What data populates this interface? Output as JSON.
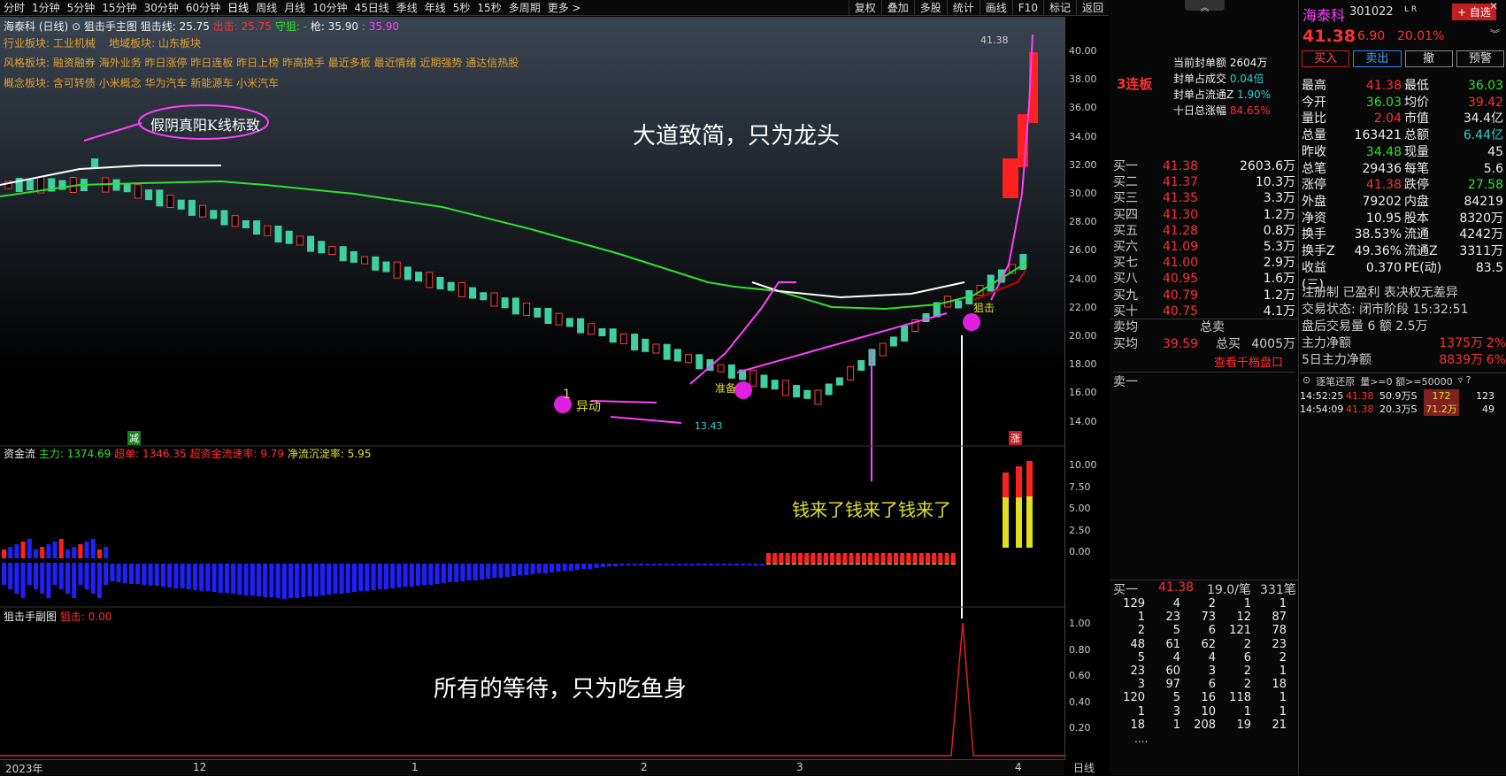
{
  "topbar": {
    "items": [
      "分时",
      "1分钟",
      "5分钟",
      "15分钟",
      "30分钟",
      "60分钟",
      "日线",
      "周线",
      "月线",
      "10分钟",
      "45日线",
      "季线",
      "年线",
      "5秒",
      "15秒",
      "多周期",
      "更多 >"
    ],
    "right": [
      "复权",
      "叠加",
      "多股",
      "统计",
      "画线",
      "F10",
      "标记",
      "返回"
    ]
  },
  "main": {
    "stock_title": "海泰科 (日线)",
    "indicator": "狙击手主图",
    "line1": "狙击线: 25.75",
    "line2": "出击: 25.75",
    "line3": "守狙: -",
    "line4": "枪: 35.90",
    "line5": ": 35.90",
    "sector1": "行业板块: 工业机械",
    "sector2": "地域板块: 山东板块",
    "style_label": "风格板块:",
    "style": "融资融券 海外业务 昨日涨停 昨日连板 昨日上榜 昨高换手 最近多板 最近情绪 近期强势 通达信热股",
    "concept_label": "概念板块:",
    "concept": "含可转债 小米概念 华为汽车 新能源车 小米汽车",
    "ann_kline": "假阴真阳K线标致",
    "ann_main": "大道致简，只为龙头",
    "ann_money": "钱来了钱来了钱来了",
    "ann_wait": "所有的等待，只为吃鱼身",
    "ann_move": "异动",
    "ann_ready": "准备",
    "ann_snipe": "狙击",
    "price_top": "41.38",
    "price_low": "13.43",
    "mark_down": "减",
    "mark_up": "涨",
    "n1": "1",
    "n2": "2",
    "n3": "3"
  },
  "yaxis_main": [
    "40.00",
    "38.00",
    "36.00",
    "34.00",
    "32.00",
    "30.00",
    "28.00",
    "26.00",
    "24.00",
    "22.00",
    "20.00",
    "18.00",
    "16.00",
    "14.00"
  ],
  "sub1": {
    "title": "资金流",
    "l1": "主力: 1374.69",
    "l2": "超单: 1346.35",
    "l3": "超资金流速率: 9.79",
    "l4": "净流沉淀率: 5.95",
    "yaxis": [
      "10.00",
      "7.50",
      "5.00",
      "2.50",
      "0.00"
    ]
  },
  "sub2": {
    "title": "狙击手副图",
    "l1": "狙击: 0.00",
    "yaxis": [
      "1.00",
      "0.80",
      "0.60",
      "0.40",
      "0.20"
    ]
  },
  "xaxis": [
    "2023年",
    "12",
    "1",
    "2",
    "3",
    "4"
  ],
  "period": "日线",
  "col1": {
    "lianban": "3连板",
    "seal_amount_l": "当前封单额",
    "seal_amount": "2604万",
    "seal_deal_l": "封单占成交",
    "seal_deal": "0.04倍",
    "seal_flow_l": "封单占流通Z",
    "seal_flow": "1.90%",
    "ten_l": "十日总涨幅",
    "ten": "84.65%",
    "bids": [
      [
        "买一",
        "41.38",
        "2603.6万"
      ],
      [
        "买二",
        "41.37",
        "10.3万"
      ],
      [
        "买三",
        "41.35",
        "3.3万"
      ],
      [
        "买四",
        "41.30",
        "1.2万"
      ],
      [
        "买五",
        "41.28",
        "0.8万"
      ],
      [
        "买六",
        "41.09",
        "5.3万"
      ],
      [
        "买七",
        "41.00",
        "2.9万"
      ],
      [
        "买八",
        "40.95",
        "1.6万"
      ],
      [
        "买九",
        "40.79",
        "1.2万"
      ],
      [
        "买十",
        "40.75",
        "4.1万"
      ]
    ],
    "sellavg_l": "卖均",
    "sellsum_l": "总卖",
    "buyavg_l": "买均",
    "buyavg": "39.59",
    "buysum_l": "总买",
    "buysum": "4005万",
    "thousand": "查看千档盘口",
    "sell1": "卖一",
    "queue_l": "买一",
    "queue_p": "41.38",
    "queue_a": "19.0/笔",
    "queue_n": "331笔",
    "queue": [
      [
        "129",
        "4",
        "2",
        "1",
        "1"
      ],
      [
        "1",
        "23",
        "73",
        "12",
        "87"
      ],
      [
        "2",
        "5",
        "6",
        "121",
        "78"
      ],
      [
        "48",
        "61",
        "62",
        "2",
        "23"
      ],
      [
        "5",
        "4",
        "4",
        "6",
        "2"
      ],
      [
        "23",
        "60",
        "3",
        "2",
        "1"
      ],
      [
        "3",
        "97",
        "6",
        "2",
        "18"
      ],
      [
        "120",
        "5",
        "16",
        "118",
        "1"
      ],
      [
        "1",
        "3",
        "10",
        "1",
        "1"
      ],
      [
        "18",
        "1",
        "208",
        "19",
        "21"
      ]
    ],
    "more": "...."
  },
  "col2": {
    "name": "海泰科",
    "code": "301022",
    "lr": "L R",
    "add": "+ 自选",
    "price": "41.38",
    "chg": "6.90",
    "pct": "20.01%",
    "buy": "买入",
    "sell": "卖出",
    "cancel": "撤",
    "warn": "预警",
    "stats": [
      [
        "最高",
        "41.38",
        "最低",
        "36.03"
      ],
      [
        "今开",
        "36.03",
        "均价",
        "39.42"
      ],
      [
        "量比",
        "2.04",
        "市值",
        "34.4亿"
      ],
      [
        "总量",
        "163421",
        "总额",
        "6.44亿"
      ],
      [
        "昨收",
        "34.48",
        "现量",
        "45"
      ],
      [
        "总笔",
        "29436",
        "每笔",
        "5.6"
      ],
      [
        "涨停",
        "41.38",
        "跌停",
        "27.58"
      ],
      [
        "外盘",
        "79202",
        "内盘",
        "84219"
      ],
      [
        "净资",
        "10.95",
        "股本",
        "8320万"
      ],
      [
        "换手",
        "38.53%",
        "流通",
        "4242万"
      ],
      [
        "换手Z",
        "49.36%",
        "流通Z",
        "3311万"
      ],
      [
        "收益(三)",
        "0.370",
        "PE(动)",
        "83.5"
      ]
    ],
    "reg": "注册制 已盈利 表决权无差异",
    "trade": "交易状态: 闭市阶段 15:32:51",
    "after": "盘后交易量 6 额 2.5万",
    "main_net_l": "主力净额",
    "main_net": "1375万",
    "main_net_p": "2%",
    "five_l": "5日主力净额",
    "five": "8839万",
    "five_p": "6%",
    "tick_title": "逐笔还原",
    "tick_filter": "量>=0 额>=50000",
    "ticks": [
      [
        "14:52:25",
        "41.38",
        "50.9万S",
        "172",
        "123"
      ],
      [
        "14:54:09",
        "41.38",
        "20.3万S",
        "71.2万",
        "49"
      ]
    ]
  }
}
